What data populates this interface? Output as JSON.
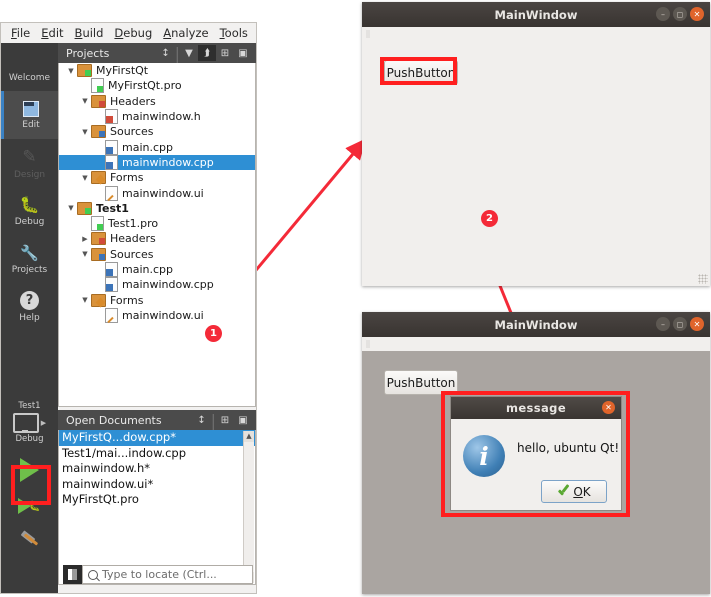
{
  "ide": {
    "menubar": [
      {
        "pre": "",
        "key": "F",
        "post": "ile"
      },
      {
        "pre": "",
        "key": "E",
        "post": "dit"
      },
      {
        "pre": "",
        "key": "B",
        "post": "uild"
      },
      {
        "pre": "",
        "key": "D",
        "post": "ebug"
      },
      {
        "pre": "",
        "key": "A",
        "post": "nalyze"
      },
      {
        "pre": "",
        "key": "T",
        "post": "ools"
      }
    ],
    "modes": [
      {
        "label": "Welcome",
        "icon": "grid-icon",
        "state": "normal"
      },
      {
        "label": "Edit",
        "icon": "edit-icon",
        "state": "selected"
      },
      {
        "label": "Design",
        "icon": "pencil-icon",
        "state": "disabled"
      },
      {
        "label": "Debug",
        "icon": "bug-icon",
        "state": "normal"
      },
      {
        "label": "Projects",
        "icon": "wrench-icon",
        "state": "normal"
      },
      {
        "label": "Help",
        "icon": "question-icon",
        "state": "normal"
      }
    ],
    "kit": {
      "name": "Test1",
      "build": "Debug",
      "monitor_icon": "monitor-icon",
      "run_icon": "run-play-icon",
      "debug_icon": "debug-play-icon",
      "build_icon": "hammer-icon"
    },
    "projects_panel": {
      "title": "Projects",
      "toolbar": [
        {
          "name": "sync-updown-icon",
          "glyph": "↕"
        },
        {
          "name": "filter-icon",
          "glyph": "ὓD"
        },
        {
          "name": "link-icon",
          "glyph": "⚭"
        },
        {
          "name": "split-icon",
          "glyph": "⊞"
        },
        {
          "name": "close-panel-icon",
          "glyph": "▣"
        }
      ],
      "tree": [
        {
          "label": "MyFirstQt",
          "indent": 0,
          "arrow": "down",
          "icon": "qt-project-folder",
          "bold": false,
          "selected": false
        },
        {
          "label": "MyFirstQt.pro",
          "indent": 1,
          "arrow": "none",
          "icon": "pro-file",
          "bold": false,
          "selected": false
        },
        {
          "label": "Headers",
          "indent": 1,
          "arrow": "down",
          "icon": "headers-folder",
          "bold": false,
          "selected": false
        },
        {
          "label": "mainwindow.h",
          "indent": 2,
          "arrow": "none",
          "icon": "h-file",
          "bold": false,
          "selected": false
        },
        {
          "label": "Sources",
          "indent": 1,
          "arrow": "down",
          "icon": "sources-folder",
          "bold": false,
          "selected": false
        },
        {
          "label": "main.cpp",
          "indent": 2,
          "arrow": "none",
          "icon": "cpp-file",
          "bold": false,
          "selected": false
        },
        {
          "label": "mainwindow.cpp",
          "indent": 2,
          "arrow": "none",
          "icon": "cpp-file",
          "bold": false,
          "selected": true
        },
        {
          "label": "Forms",
          "indent": 1,
          "arrow": "down",
          "icon": "forms-folder",
          "bold": false,
          "selected": false
        },
        {
          "label": "mainwindow.ui",
          "indent": 2,
          "arrow": "none",
          "icon": "ui-file",
          "bold": false,
          "selected": false
        },
        {
          "label": "Test1",
          "indent": 0,
          "arrow": "down",
          "icon": "qt-project-folder",
          "bold": true,
          "selected": false
        },
        {
          "label": "Test1.pro",
          "indent": 1,
          "arrow": "none",
          "icon": "pro-file",
          "bold": false,
          "selected": false
        },
        {
          "label": "Headers",
          "indent": 1,
          "arrow": "right",
          "icon": "headers-folder",
          "bold": false,
          "selected": false
        },
        {
          "label": "Sources",
          "indent": 1,
          "arrow": "down",
          "icon": "sources-folder",
          "bold": false,
          "selected": false
        },
        {
          "label": "main.cpp",
          "indent": 2,
          "arrow": "none",
          "icon": "cpp-file",
          "bold": false,
          "selected": false
        },
        {
          "label": "mainwindow.cpp",
          "indent": 2,
          "arrow": "none",
          "icon": "cpp-file",
          "bold": false,
          "selected": false
        },
        {
          "label": "Forms",
          "indent": 1,
          "arrow": "down",
          "icon": "forms-folder",
          "bold": false,
          "selected": false
        },
        {
          "label": "mainwindow.ui",
          "indent": 2,
          "arrow": "none",
          "icon": "ui-file",
          "bold": false,
          "selected": false
        }
      ]
    },
    "open_documents": {
      "title": "Open Documents",
      "toolbar": [
        {
          "name": "sync-updown-icon",
          "glyph": "↕"
        },
        {
          "name": "split-icon",
          "glyph": "⊞"
        },
        {
          "name": "close-panel-icon",
          "glyph": "▣"
        }
      ],
      "items": [
        {
          "label": "MyFirstQ...dow.cpp*",
          "selected": true
        },
        {
          "label": "Test1/mai...indow.cpp",
          "selected": false
        },
        {
          "label": "mainwindow.h*",
          "selected": false
        },
        {
          "label": "mainwindow.ui*",
          "selected": false
        },
        {
          "label": "MyFirstQt.pro",
          "selected": false
        }
      ]
    },
    "locator": {
      "placeholder": "Type to locate (Ctrl...",
      "icon": "search-icon",
      "sidebar_toggle": "toggle-sidebar-icon"
    }
  },
  "app_window_1": {
    "title": "MainWindow",
    "button_label": "PushButton",
    "window_buttons": [
      {
        "name": "minimize-button",
        "glyph": "–"
      },
      {
        "name": "maximize-button",
        "glyph": "□"
      },
      {
        "name": "close-button",
        "glyph": "×"
      }
    ]
  },
  "app_window_2": {
    "title": "MainWindow",
    "button_label": "PushButton",
    "window_buttons": [
      {
        "name": "minimize-button",
        "glyph": "–"
      },
      {
        "name": "maximize-button",
        "glyph": "□"
      },
      {
        "name": "close-button",
        "glyph": "×"
      }
    ]
  },
  "message_dialog": {
    "title": "message",
    "text": "hello, ubuntu Qt!",
    "icon": "information-icon",
    "icon_glyph": "i",
    "ok_pre": "",
    "ok_key": "O",
    "ok_post": "K",
    "close_glyph": "×"
  },
  "annotations": {
    "markers": [
      {
        "label": "1"
      },
      {
        "label": "2"
      }
    ],
    "color": "#ff1f1f"
  }
}
